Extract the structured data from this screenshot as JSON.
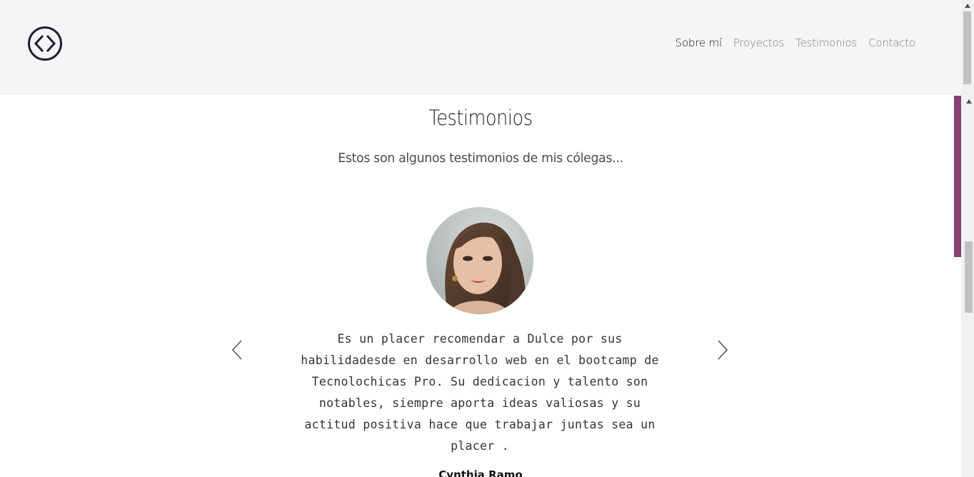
{
  "nav": {
    "logo_icon": "code-brackets-circle-icon",
    "links": [
      {
        "label": "Sobre mí",
        "active": true
      },
      {
        "label": "Proyectos",
        "active": false
      },
      {
        "label": "Testimonios",
        "active": false
      },
      {
        "label": "Contacto",
        "active": false
      }
    ]
  },
  "testimonials": {
    "title": "Testimonios",
    "subtitle": "Estos son algunos testimonios de mis cólegas...",
    "current": {
      "quote_lines": [
        "Es un placer recomendar a Dulce por sus",
        "habilidadesde en desarrollo web en el bootcamp de",
        "Tecnolochicas Pro. Su dedicacion y talento son",
        "notables, siempre aporta ideas valiosas y su",
        "actitud positiva hace que trabajar juntas sea un",
        "placer ."
      ],
      "author": "Cynthia Ramo"
    },
    "prev_icon": "chevron-left-icon",
    "next_icon": "chevron-right-icon"
  },
  "colors": {
    "navbar_bg": "#f4f5f7",
    "accent": "#85416f",
    "text_dark": "#222222",
    "nav_inactive": "#7a7a7a"
  }
}
